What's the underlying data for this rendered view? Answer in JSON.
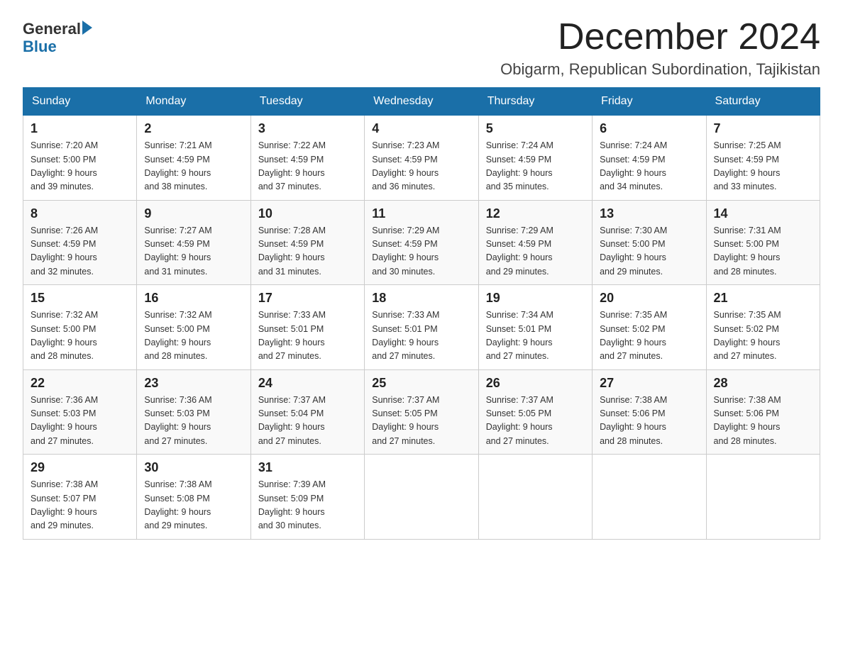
{
  "header": {
    "logo_general": "General",
    "logo_blue": "Blue",
    "main_title": "December 2024",
    "sub_title": "Obigarm, Republican Subordination, Tajikistan"
  },
  "days_of_week": [
    "Sunday",
    "Monday",
    "Tuesday",
    "Wednesday",
    "Thursday",
    "Friday",
    "Saturday"
  ],
  "weeks": [
    [
      {
        "day": "1",
        "sunrise": "7:20 AM",
        "sunset": "5:00 PM",
        "daylight": "9 hours and 39 minutes."
      },
      {
        "day": "2",
        "sunrise": "7:21 AM",
        "sunset": "4:59 PM",
        "daylight": "9 hours and 38 minutes."
      },
      {
        "day": "3",
        "sunrise": "7:22 AM",
        "sunset": "4:59 PM",
        "daylight": "9 hours and 37 minutes."
      },
      {
        "day": "4",
        "sunrise": "7:23 AM",
        "sunset": "4:59 PM",
        "daylight": "9 hours and 36 minutes."
      },
      {
        "day": "5",
        "sunrise": "7:24 AM",
        "sunset": "4:59 PM",
        "daylight": "9 hours and 35 minutes."
      },
      {
        "day": "6",
        "sunrise": "7:24 AM",
        "sunset": "4:59 PM",
        "daylight": "9 hours and 34 minutes."
      },
      {
        "day": "7",
        "sunrise": "7:25 AM",
        "sunset": "4:59 PM",
        "daylight": "9 hours and 33 minutes."
      }
    ],
    [
      {
        "day": "8",
        "sunrise": "7:26 AM",
        "sunset": "4:59 PM",
        "daylight": "9 hours and 32 minutes."
      },
      {
        "day": "9",
        "sunrise": "7:27 AM",
        "sunset": "4:59 PM",
        "daylight": "9 hours and 31 minutes."
      },
      {
        "day": "10",
        "sunrise": "7:28 AM",
        "sunset": "4:59 PM",
        "daylight": "9 hours and 31 minutes."
      },
      {
        "day": "11",
        "sunrise": "7:29 AM",
        "sunset": "4:59 PM",
        "daylight": "9 hours and 30 minutes."
      },
      {
        "day": "12",
        "sunrise": "7:29 AM",
        "sunset": "4:59 PM",
        "daylight": "9 hours and 29 minutes."
      },
      {
        "day": "13",
        "sunrise": "7:30 AM",
        "sunset": "5:00 PM",
        "daylight": "9 hours and 29 minutes."
      },
      {
        "day": "14",
        "sunrise": "7:31 AM",
        "sunset": "5:00 PM",
        "daylight": "9 hours and 28 minutes."
      }
    ],
    [
      {
        "day": "15",
        "sunrise": "7:32 AM",
        "sunset": "5:00 PM",
        "daylight": "9 hours and 28 minutes."
      },
      {
        "day": "16",
        "sunrise": "7:32 AM",
        "sunset": "5:00 PM",
        "daylight": "9 hours and 28 minutes."
      },
      {
        "day": "17",
        "sunrise": "7:33 AM",
        "sunset": "5:01 PM",
        "daylight": "9 hours and 27 minutes."
      },
      {
        "day": "18",
        "sunrise": "7:33 AM",
        "sunset": "5:01 PM",
        "daylight": "9 hours and 27 minutes."
      },
      {
        "day": "19",
        "sunrise": "7:34 AM",
        "sunset": "5:01 PM",
        "daylight": "9 hours and 27 minutes."
      },
      {
        "day": "20",
        "sunrise": "7:35 AM",
        "sunset": "5:02 PM",
        "daylight": "9 hours and 27 minutes."
      },
      {
        "day": "21",
        "sunrise": "7:35 AM",
        "sunset": "5:02 PM",
        "daylight": "9 hours and 27 minutes."
      }
    ],
    [
      {
        "day": "22",
        "sunrise": "7:36 AM",
        "sunset": "5:03 PM",
        "daylight": "9 hours and 27 minutes."
      },
      {
        "day": "23",
        "sunrise": "7:36 AM",
        "sunset": "5:03 PM",
        "daylight": "9 hours and 27 minutes."
      },
      {
        "day": "24",
        "sunrise": "7:37 AM",
        "sunset": "5:04 PM",
        "daylight": "9 hours and 27 minutes."
      },
      {
        "day": "25",
        "sunrise": "7:37 AM",
        "sunset": "5:05 PM",
        "daylight": "9 hours and 27 minutes."
      },
      {
        "day": "26",
        "sunrise": "7:37 AM",
        "sunset": "5:05 PM",
        "daylight": "9 hours and 27 minutes."
      },
      {
        "day": "27",
        "sunrise": "7:38 AM",
        "sunset": "5:06 PM",
        "daylight": "9 hours and 28 minutes."
      },
      {
        "day": "28",
        "sunrise": "7:38 AM",
        "sunset": "5:06 PM",
        "daylight": "9 hours and 28 minutes."
      }
    ],
    [
      {
        "day": "29",
        "sunrise": "7:38 AM",
        "sunset": "5:07 PM",
        "daylight": "9 hours and 29 minutes."
      },
      {
        "day": "30",
        "sunrise": "7:38 AM",
        "sunset": "5:08 PM",
        "daylight": "9 hours and 29 minutes."
      },
      {
        "day": "31",
        "sunrise": "7:39 AM",
        "sunset": "5:09 PM",
        "daylight": "9 hours and 30 minutes."
      },
      null,
      null,
      null,
      null
    ]
  ],
  "labels": {
    "sunrise": "Sunrise:",
    "sunset": "Sunset:",
    "daylight": "Daylight:"
  }
}
